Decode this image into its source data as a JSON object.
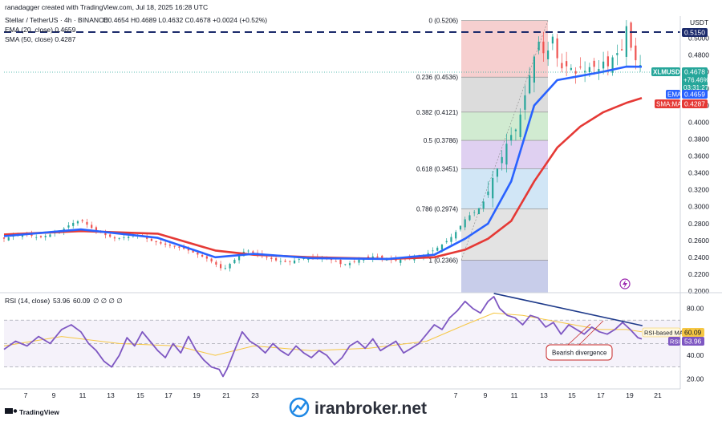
{
  "header": {
    "attribution": "ranadagger created with TradingView.com, Jul 18, 2025 16:28 UTC",
    "symbol_line": "Stellar / TetherUS · 4h · BINANCE",
    "ohlc": "O0.4654 H0.4689 L0.4632 C0.4678 +0.0024 (+0.52%)",
    "ema_legend": "EMA (20, close) 0.4659",
    "sma_legend": "SMA (50, close) 0.4287",
    "currency": "USDT"
  },
  "rsi_legend": {
    "name": "RSI (14, close)",
    "rsi": "53.96",
    "ma": "60.09",
    "extra": "∅ ∅ ∅ ∅"
  },
  "price_tags": {
    "top": "0.5150",
    "symbol": "XLMUSDT",
    "last": "0.4678",
    "change": "+76.46%",
    "countdown": "03:31:27",
    "ema_label": "EMA",
    "ema_value": "0.4659",
    "sma_label": "SMA:MA",
    "sma_value": "0.4287"
  },
  "rsi_tags": {
    "ma_label": "RSI-based MA",
    "ma_value": "60.09",
    "rsi_label": "RSI",
    "rsi_value": "53.96"
  },
  "annotation": "Bearish divergence",
  "footer": {
    "brand": "TradingView",
    "watermark": "iranbroker.net"
  },
  "colors": {
    "ema": "#2962ff",
    "sma": "#e53935",
    "up": "#26a69a",
    "down": "#ef5350",
    "rsi": "#7e57c2",
    "rsi_ma": "#f6c744",
    "divergence": "#1e3a8a"
  },
  "chart_data": [
    {
      "type": "candlestick",
      "title": "Stellar / TetherUS · 4h · BINANCE",
      "x_ticks": [
        "7",
        "9",
        "11",
        "13",
        "15",
        "17",
        "19",
        "21",
        "23",
        "7",
        "9",
        "11",
        "13",
        "15",
        "17",
        "19",
        "21"
      ],
      "y_ticks": [
        "0.5000",
        "0.4800",
        "0.4600",
        "0.4400",
        "0.4200",
        "0.4000",
        "0.3800",
        "0.3600",
        "0.3400",
        "0.3200",
        "0.3000",
        "0.2800",
        "0.2600",
        "0.2400",
        "0.2200",
        "0.2000"
      ],
      "ylim": [
        0.198,
        0.526
      ],
      "grid": false,
      "fibonacci": [
        {
          "label": "0 (0.5206)",
          "value": 0.5206
        },
        {
          "label": "0.236 (0.4536)",
          "value": 0.4536
        },
        {
          "label": "0.382 (0.4121)",
          "value": 0.4121
        },
        {
          "label": "0.5 (0.3786)",
          "value": 0.3786
        },
        {
          "label": "0.618 (0.3451)",
          "value": 0.3451
        },
        {
          "label": "0.786 (0.2974)",
          "value": 0.2974
        },
        {
          "label": "1 (0.2366)",
          "value": 0.2366
        }
      ],
      "resistance_level": 0.515,
      "price_path": [
        [
          0,
          0.262
        ],
        [
          6,
          0.266
        ],
        [
          12,
          0.267
        ],
        [
          18,
          0.263
        ],
        [
          24,
          0.267
        ],
        [
          30,
          0.272
        ],
        [
          35,
          0.28
        ],
        [
          40,
          0.284
        ],
        [
          46,
          0.274
        ],
        [
          52,
          0.267
        ],
        [
          58,
          0.262
        ],
        [
          64,
          0.264
        ],
        [
          70,
          0.267
        ],
        [
          76,
          0.26
        ],
        [
          82,
          0.256
        ],
        [
          88,
          0.253
        ],
        [
          94,
          0.25
        ],
        [
          100,
          0.244
        ],
        [
          106,
          0.238
        ],
        [
          110,
          0.232
        ],
        [
          114,
          0.225
        ],
        [
          118,
          0.233
        ],
        [
          122,
          0.241
        ],
        [
          126,
          0.249
        ],
        [
          130,
          0.245
        ],
        [
          136,
          0.24
        ],
        [
          142,
          0.236
        ],
        [
          148,
          0.234
        ],
        [
          154,
          0.238
        ],
        [
          160,
          0.24
        ],
        [
          166,
          0.239
        ],
        [
          172,
          0.236
        ],
        [
          176,
          0.231
        ],
        [
          180,
          0.233
        ],
        [
          186,
          0.238
        ],
        [
          192,
          0.241
        ],
        [
          198,
          0.238
        ],
        [
          204,
          0.236
        ],
        [
          210,
          0.239
        ],
        [
          216,
          0.24
        ],
        [
          220,
          0.244
        ],
        [
          224,
          0.249
        ],
        [
          228,
          0.255
        ],
        [
          232,
          0.262
        ],
        [
          236,
          0.272
        ],
        [
          240,
          0.285
        ],
        [
          243,
          0.291
        ],
        [
          246,
          0.295
        ],
        [
          249,
          0.303
        ],
        [
          252,
          0.318
        ],
        [
          255,
          0.338
        ],
        [
          258,
          0.35
        ],
        [
          261,
          0.372
        ],
        [
          264,
          0.385
        ],
        [
          267,
          0.393
        ],
        [
          270,
          0.42
        ],
        [
          273,
          0.45
        ],
        [
          276,
          0.478
        ],
        [
          279,
          0.5
        ],
        [
          282,
          0.47
        ],
        [
          285,
          0.508
        ],
        [
          288,
          0.476
        ],
        [
          291,
          0.461
        ],
        [
          294,
          0.47
        ],
        [
          297,
          0.456
        ],
        [
          300,
          0.465
        ],
        [
          303,
          0.46
        ],
        [
          306,
          0.469
        ],
        [
          309,
          0.461
        ],
        [
          312,
          0.472
        ],
        [
          315,
          0.465
        ],
        [
          318,
          0.485
        ],
        [
          321,
          0.478
        ],
        [
          324,
          0.514
        ],
        [
          327,
          0.482
        ],
        [
          330,
          0.468
        ],
        [
          332,
          0.4678
        ]
      ],
      "ema20_path": [
        [
          0,
          0.265
        ],
        [
          40,
          0.273
        ],
        [
          80,
          0.263
        ],
        [
          110,
          0.24
        ],
        [
          130,
          0.244
        ],
        [
          160,
          0.239
        ],
        [
          200,
          0.238
        ],
        [
          224,
          0.243
        ],
        [
          240,
          0.262
        ],
        [
          252,
          0.28
        ],
        [
          264,
          0.33
        ],
        [
          276,
          0.42
        ],
        [
          288,
          0.45
        ],
        [
          300,
          0.455
        ],
        [
          312,
          0.46
        ],
        [
          324,
          0.466
        ],
        [
          332,
          0.4659
        ]
      ],
      "sma50_path": [
        [
          0,
          0.267
        ],
        [
          40,
          0.271
        ],
        [
          80,
          0.268
        ],
        [
          110,
          0.248
        ],
        [
          130,
          0.243
        ],
        [
          160,
          0.24
        ],
        [
          200,
          0.238
        ],
        [
          224,
          0.24
        ],
        [
          240,
          0.249
        ],
        [
          252,
          0.262
        ],
        [
          264,
          0.283
        ],
        [
          276,
          0.33
        ],
        [
          288,
          0.37
        ],
        [
          300,
          0.395
        ],
        [
          312,
          0.412
        ],
        [
          324,
          0.423
        ],
        [
          332,
          0.4287
        ]
      ]
    },
    {
      "type": "line",
      "title": "RSI (14, close)",
      "y_ticks": [
        "80.00",
        "60.00",
        "40.00",
        "20.00"
      ],
      "ylim": [
        12,
        92
      ],
      "band": [
        30,
        70
      ],
      "series": [
        {
          "name": "RSI",
          "path": [
            [
              0,
              45
            ],
            [
              6,
              52
            ],
            [
              12,
              48
            ],
            [
              18,
              56
            ],
            [
              24,
              50
            ],
            [
              30,
              62
            ],
            [
              35,
              66
            ],
            [
              40,
              60
            ],
            [
              44,
              50
            ],
            [
              48,
              44
            ],
            [
              52,
              35
            ],
            [
              56,
              30
            ],
            [
              60,
              40
            ],
            [
              64,
              55
            ],
            [
              68,
              48
            ],
            [
              72,
              60
            ],
            [
              76,
              52
            ],
            [
              80,
              44
            ],
            [
              84,
              38
            ],
            [
              88,
              50
            ],
            [
              92,
              42
            ],
            [
              96,
              56
            ],
            [
              100,
              44
            ],
            [
              104,
              36
            ],
            [
              108,
              30
            ],
            [
              112,
              28
            ],
            [
              114,
              22
            ],
            [
              116,
              28
            ],
            [
              120,
              44
            ],
            [
              124,
              60
            ],
            [
              128,
              52
            ],
            [
              132,
              48
            ],
            [
              136,
              42
            ],
            [
              140,
              50
            ],
            [
              144,
              44
            ],
            [
              148,
              40
            ],
            [
              152,
              48
            ],
            [
              156,
              42
            ],
            [
              160,
              38
            ],
            [
              164,
              44
            ],
            [
              168,
              40
            ],
            [
              172,
              32
            ],
            [
              176,
              38
            ],
            [
              180,
              48
            ],
            [
              184,
              52
            ],
            [
              188,
              46
            ],
            [
              192,
              54
            ],
            [
              196,
              44
            ],
            [
              200,
              48
            ],
            [
              204,
              52
            ],
            [
              208,
              42
            ],
            [
              212,
              46
            ],
            [
              216,
              50
            ],
            [
              220,
              58
            ],
            [
              224,
              66
            ],
            [
              228,
              62
            ],
            [
              232,
              72
            ],
            [
              236,
              78
            ],
            [
              240,
              86
            ],
            [
              244,
              80
            ],
            [
              248,
              76
            ],
            [
              252,
              86
            ],
            [
              255,
              90
            ],
            [
              258,
              80
            ],
            [
              262,
              74
            ],
            [
              266,
              72
            ],
            [
              270,
              66
            ],
            [
              274,
              74
            ],
            [
              278,
              72
            ],
            [
              282,
              64
            ],
            [
              286,
              68
            ],
            [
              290,
              58
            ],
            [
              294,
              66
            ],
            [
              298,
              62
            ],
            [
              302,
              58
            ],
            [
              306,
              64
            ],
            [
              310,
              60
            ],
            [
              314,
              58
            ],
            [
              318,
              62
            ],
            [
              322,
              68
            ],
            [
              326,
              62
            ],
            [
              330,
              55
            ],
            [
              332,
              53.96
            ]
          ]
        },
        {
          "name": "RSI-based MA",
          "path": [
            [
              0,
              48
            ],
            [
              30,
              56
            ],
            [
              60,
              50
            ],
            [
              90,
              48
            ],
            [
              110,
              40
            ],
            [
              130,
              48
            ],
            [
              160,
              44
            ],
            [
              190,
              46
            ],
            [
              220,
              52
            ],
            [
              240,
              66
            ],
            [
              255,
              76
            ],
            [
              270,
              74
            ],
            [
              290,
              68
            ],
            [
              310,
              62
            ],
            [
              324,
              62
            ],
            [
              332,
              60.09
            ]
          ]
        }
      ],
      "divergence_line": [
        [
          255,
          90
        ],
        [
          324,
          68
        ]
      ]
    }
  ]
}
